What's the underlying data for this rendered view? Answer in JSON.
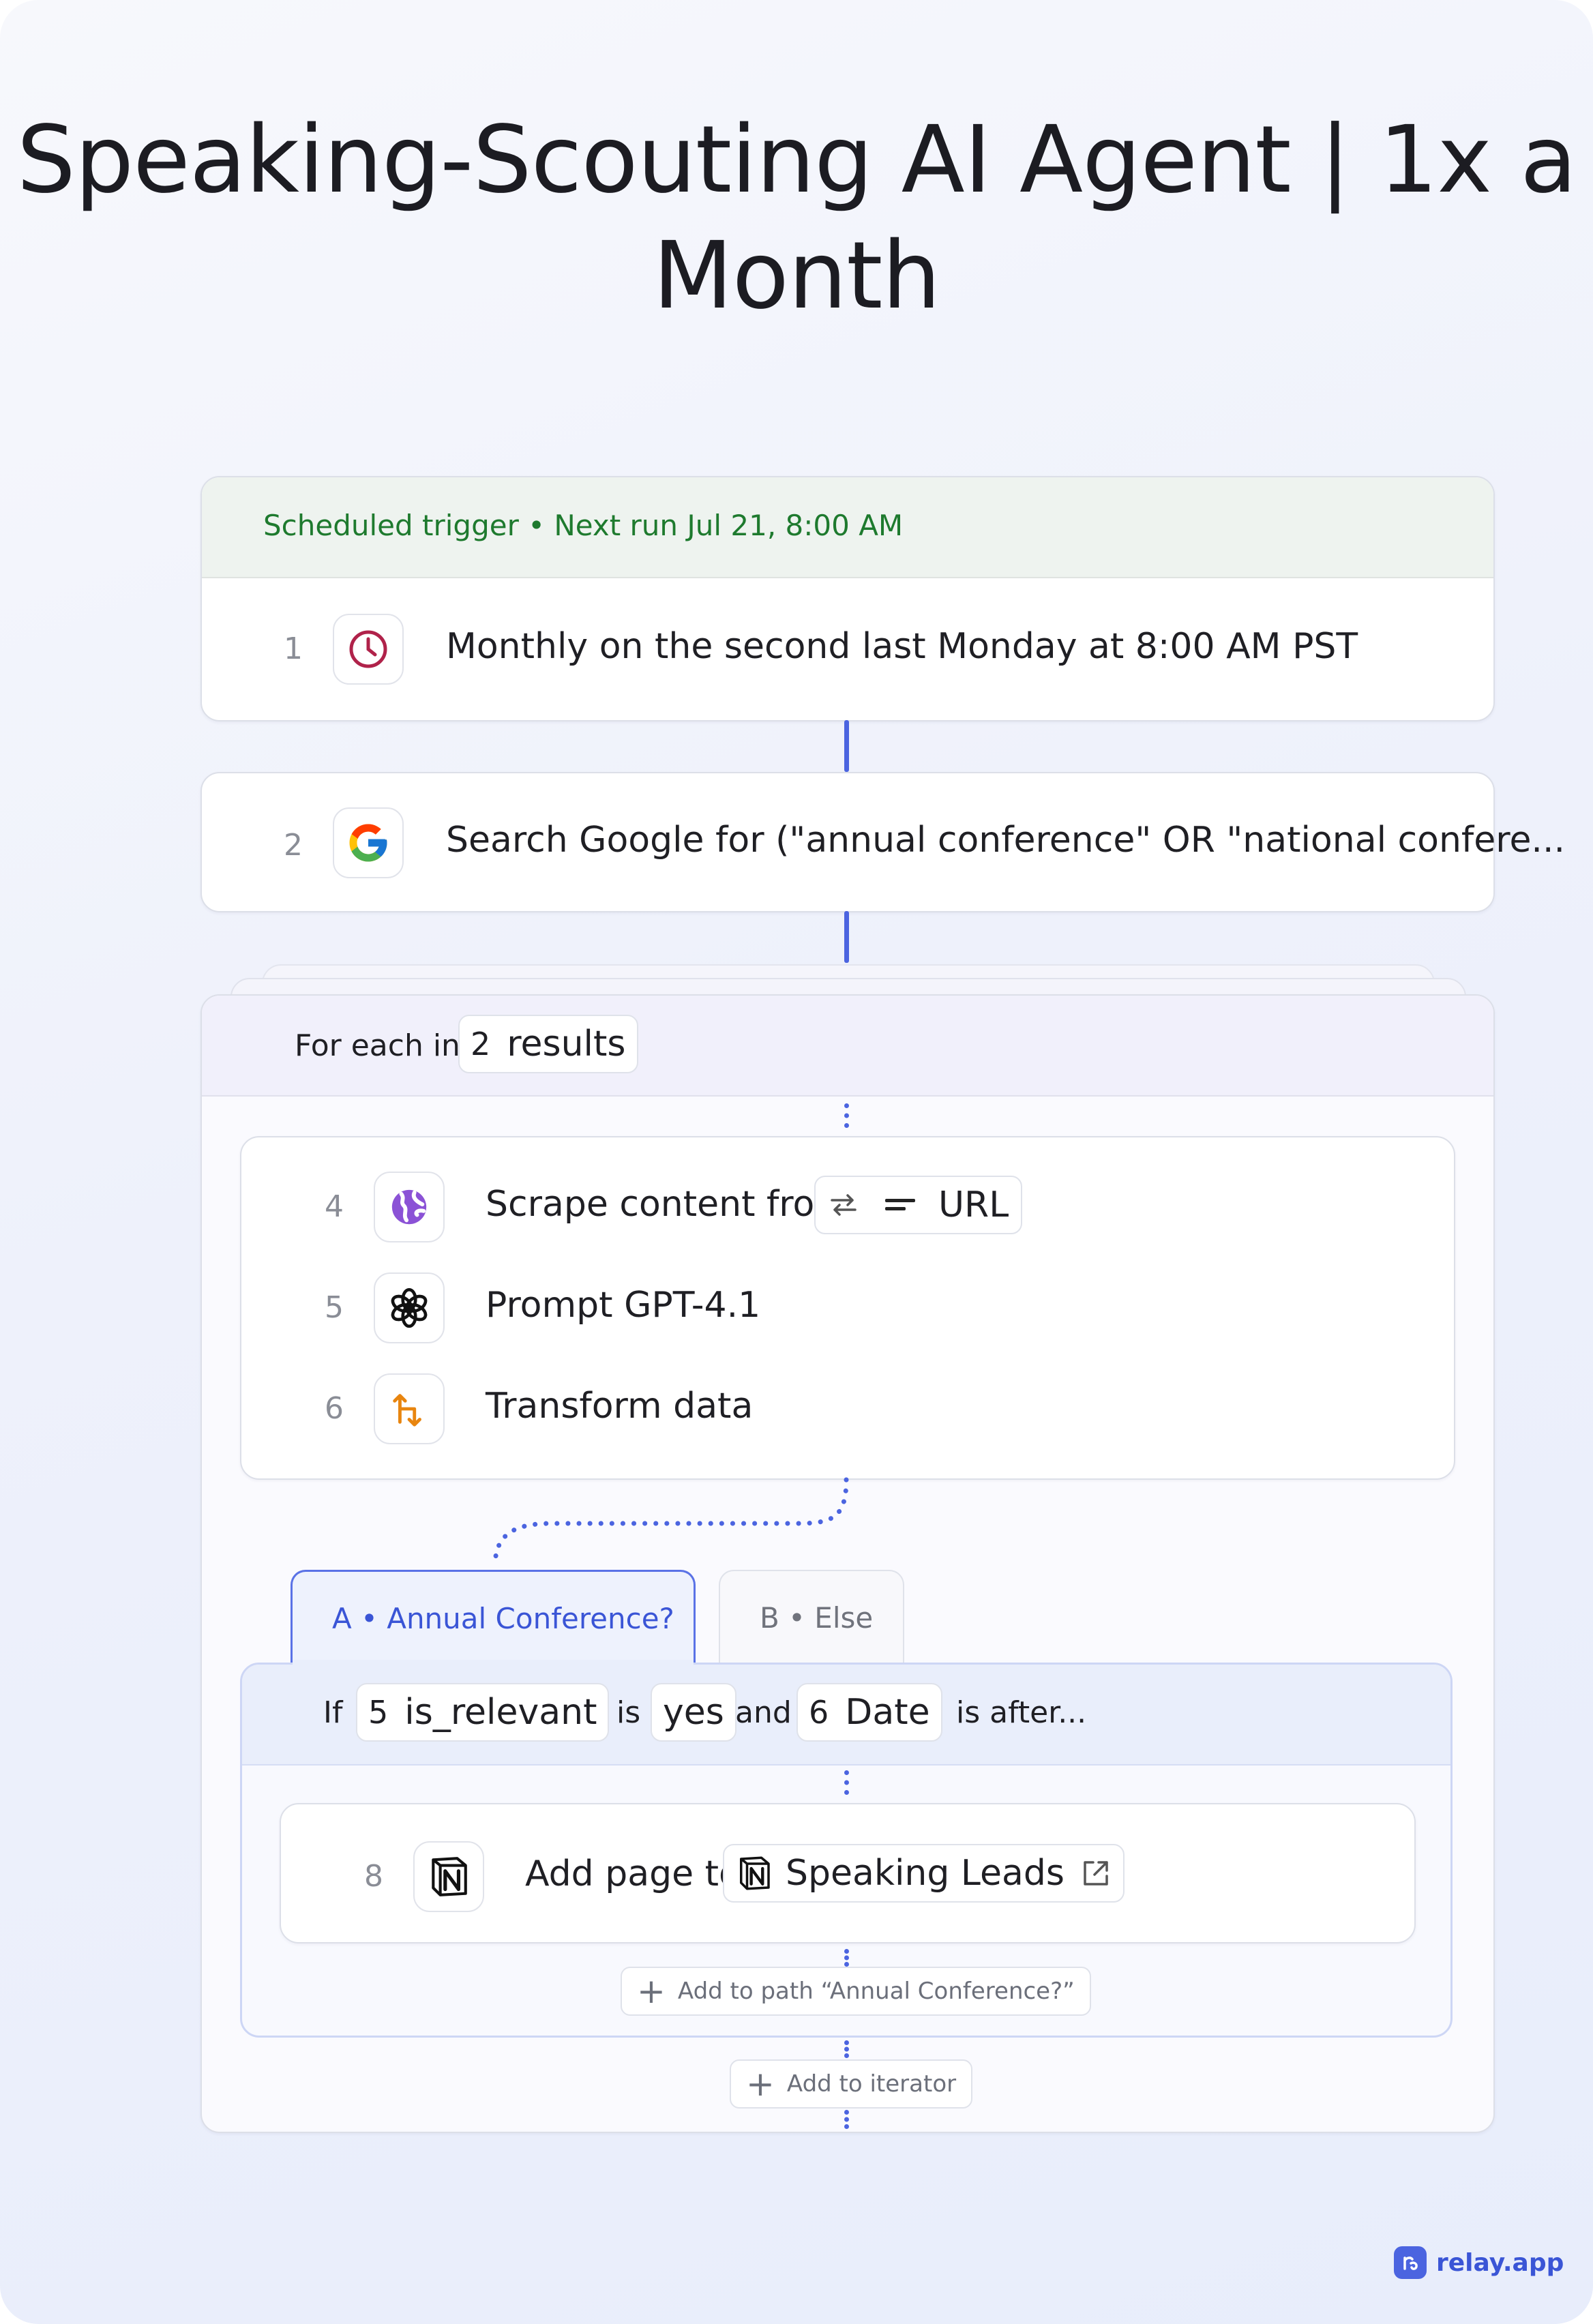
{
  "title": {
    "line1": "Speaking-Scouting AI Agent | 1x a",
    "line2": "Month"
  },
  "trigger": {
    "header": "Scheduled trigger • Next run Jul 21, 8:00 AM",
    "step_number": "1",
    "text": "Monthly on the second last Monday at 8:00 AM PST",
    "icon": "clock-icon"
  },
  "search_step": {
    "step_number": "2",
    "text": "Search Google for (\"annual conference\" OR \"national confere...",
    "icon": "google-icon"
  },
  "iterator": {
    "label": "For each in",
    "chip_number": "2",
    "chip_label": "results",
    "steps": [
      {
        "number": "4",
        "text": "Scrape content from",
        "icon": "globe-icon",
        "chip_label": "URL"
      },
      {
        "number": "5",
        "text": "Prompt GPT-4.1",
        "icon": "openai-icon"
      },
      {
        "number": "6",
        "text": "Transform data",
        "icon": "transform-icon"
      }
    ],
    "add_button": "Add to iterator"
  },
  "paths": {
    "tab_a": "A • Annual Conference?",
    "tab_b": "B • Else",
    "condition": {
      "if": "If",
      "chip1_number": "5",
      "chip1_label": "is_relevant",
      "is": "is",
      "chip2_label": "yes",
      "and": "and",
      "chip3_number": "6",
      "chip3_label": "Date",
      "tail": "is after..."
    },
    "step": {
      "number": "8",
      "text": "Add page to",
      "icon": "notion-icon",
      "chip_label": "Speaking Leads"
    },
    "add_button": "Add to path “Annual Conference?”"
  },
  "brand": {
    "name": "relay.app",
    "accent": "#4b64e0"
  },
  "colors": {
    "trigger_header_bg": "#eef3ef",
    "trigger_header_text": "#1e7a2e",
    "iterator_header_bg": "#f1f0fb",
    "path_header_bg": "#e9eefb",
    "tab_active_text": "#3a55d6"
  }
}
